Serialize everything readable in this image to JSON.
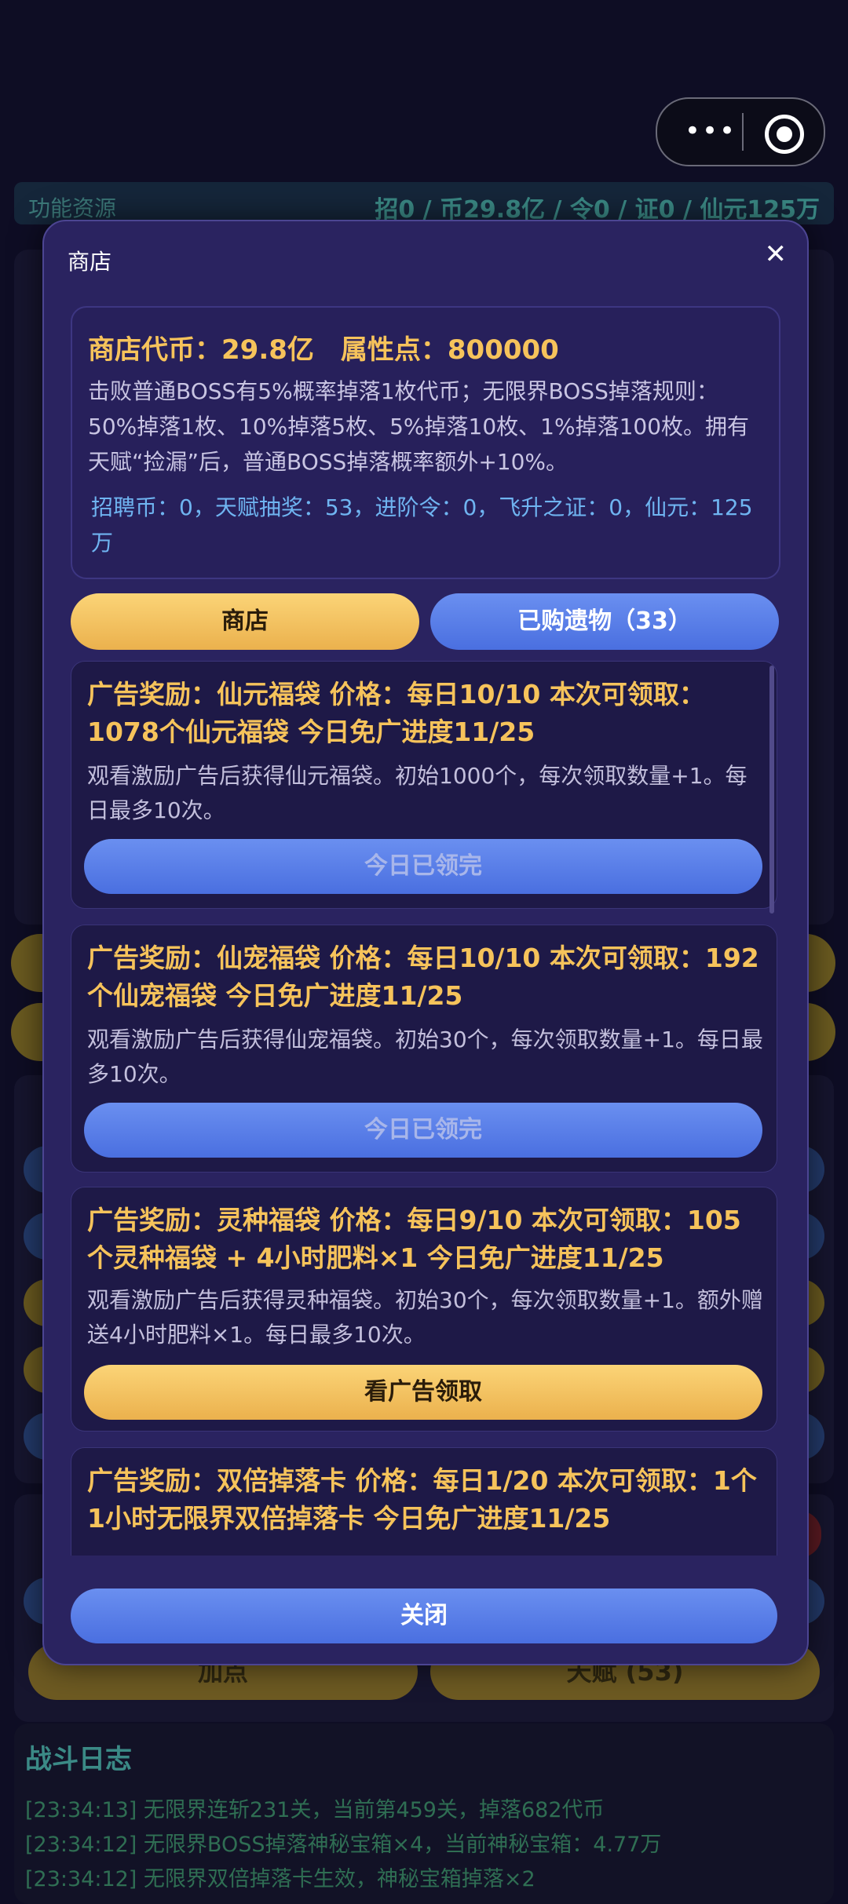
{
  "background": {
    "capsule": {
      "more_icon": "more-dots-icon",
      "target_icon": "target-icon"
    },
    "resource_bar": {
      "label": "功能资源",
      "value": "招0 / 币29.8亿 / 令0 / 证0 / 仙元125万"
    },
    "bottom_buttons": {
      "add_points": "加点",
      "talent": "天赋 (53)"
    },
    "battle_log": {
      "title": "战斗日志",
      "lines": [
        "[23:34:13] 无限界连斩231关，当前第459关，掉落682代币",
        "[23:34:12] 无限界BOSS掉落神秘宝箱×4，当前神秘宝箱：4.77万",
        "[23:34:12] 无限界双倍掉落卡生效，神秘宝箱掉落×2"
      ]
    }
  },
  "modal": {
    "title": "商店",
    "close_icon": "✕",
    "info": {
      "header": "商店代币：29.8亿　属性点：800000",
      "description": "击败普通BOSS有5%概率掉落1枚代币；无限界BOSS掉落规则：50%掉落1枚、10%掉落5枚、5%掉落10枚、1%掉落100枚。拥有天赋“捡漏”后，普通BOSS掉落概率额外+10%。",
      "stats": "招聘币：0，天赋抽奖：53，进阶令：0，飞升之证：0，仙元：125万"
    },
    "tabs": {
      "shop": "商店",
      "bought": "已购遗物（33）"
    },
    "items": [
      {
        "title": "广告奖励：仙元福袋  价格：每日10/10  本次可领取：1078个仙元福袋  今日免广进度11/25",
        "desc": "观看激励广告后获得仙元福袋。初始1000个，每次领取数量+1。每日最多10次。",
        "button": "今日已领完"
      },
      {
        "title": "广告奖励：仙宠福袋  价格：每日10/10  本次可领取：192个仙宠福袋  今日免广进度11/25",
        "desc": "观看激励广告后获得仙宠福袋。初始30个，每次领取数量+1。每日最多10次。",
        "button": "今日已领完"
      },
      {
        "title": "广告奖励：灵种福袋  价格：每日9/10  本次可领取：105个灵种福袋 + 4小时肥料×1  今日免广进度11/25",
        "desc": "观看激励广告后获得灵种福袋。初始30个，每次领取数量+1。额外赠送4小时肥料×1。每日最多10次。",
        "button": "看广告领取"
      },
      {
        "title": "广告奖励：双倍掉落卡  价格：每日1/20  本次可领取：1个1小时无限界双倍掉落卡  今日免广进度11/25"
      }
    ],
    "close_button": "关闭"
  }
}
